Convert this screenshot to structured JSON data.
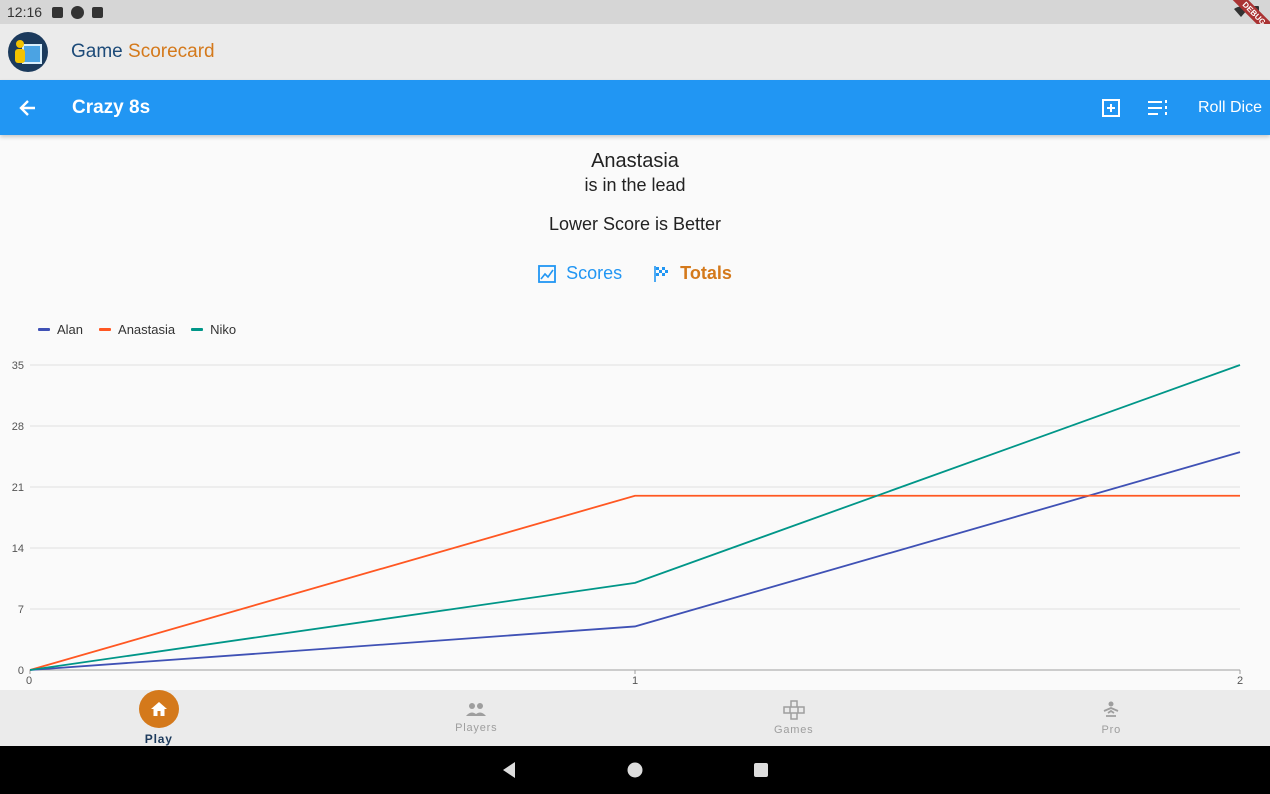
{
  "status": {
    "time": "12:16",
    "debug_label": "DEBUG"
  },
  "app": {
    "title_part1": "Game",
    "title_part2": "Scorecard"
  },
  "toolbar": {
    "title": "Crazy 8s",
    "roll_dice_label": "Roll Dice"
  },
  "lead": {
    "name": "Anastasia",
    "subtitle": "is in the lead",
    "rule": "Lower Score is Better"
  },
  "tabs": {
    "scores": "Scores",
    "totals": "Totals"
  },
  "legend": [
    {
      "name": "Alan",
      "color": "#3f51b5"
    },
    {
      "name": "Anastasia",
      "color": "#ff5722"
    },
    {
      "name": "Niko",
      "color": "#009688"
    }
  ],
  "chart_data": {
    "type": "line",
    "x": [
      0,
      1,
      2
    ],
    "series": [
      {
        "name": "Alan",
        "values": [
          0,
          5,
          25
        ],
        "color": "#3f51b5"
      },
      {
        "name": "Anastasia",
        "values": [
          0,
          20,
          20
        ],
        "color": "#ff5722"
      },
      {
        "name": "Niko",
        "values": [
          0,
          10,
          35
        ],
        "color": "#009688"
      }
    ],
    "yticks": [
      0,
      7,
      14,
      21,
      28,
      35
    ],
    "xticks": [
      0,
      1,
      2
    ],
    "ylim": [
      0,
      35
    ],
    "xlim": [
      0,
      2
    ],
    "grid": true,
    "legend_position": "top-left"
  },
  "bottom_nav": {
    "play": "Play",
    "players": "Players",
    "games": "Games",
    "pro": "Pro"
  }
}
